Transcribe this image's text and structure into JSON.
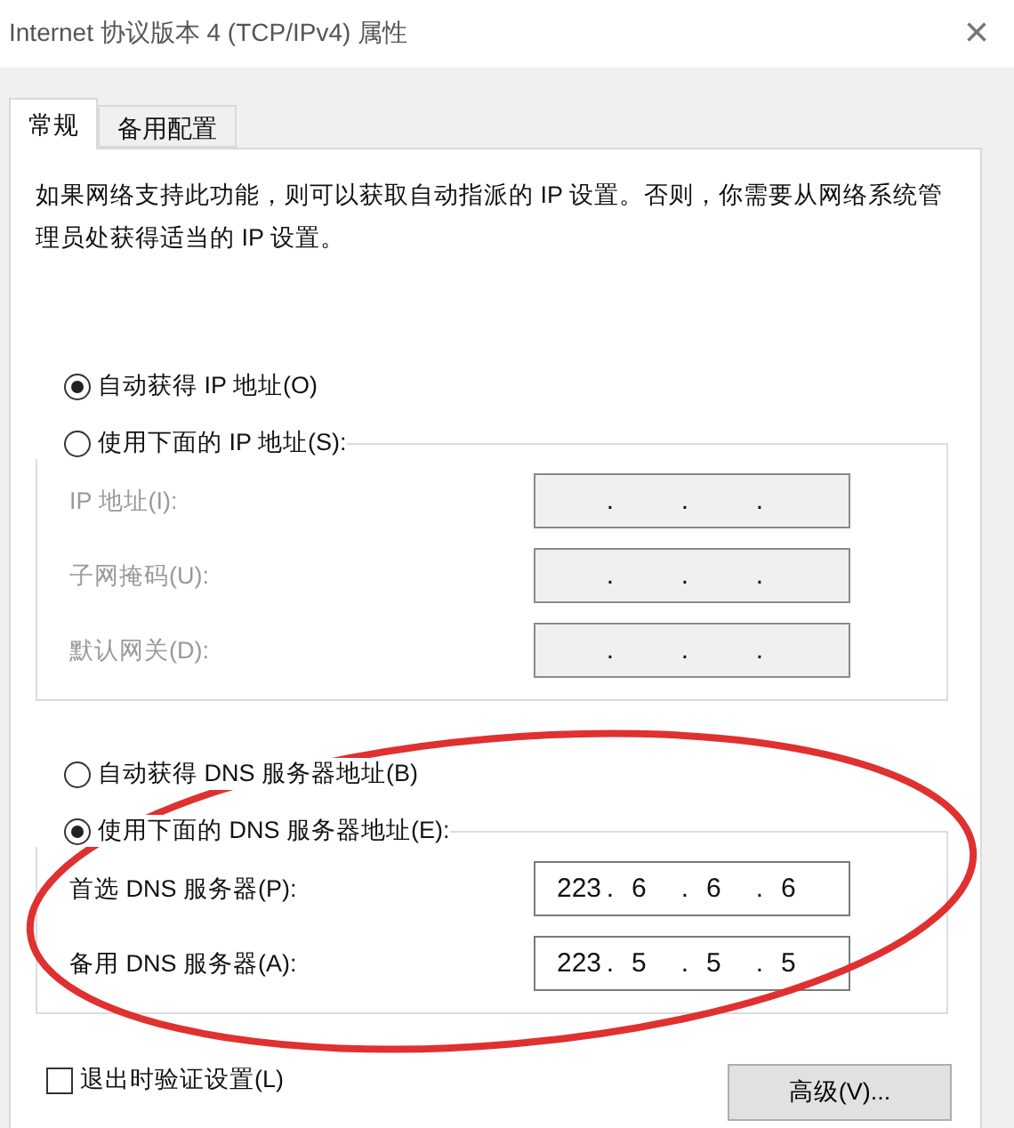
{
  "window": {
    "title": "Internet 协议版本 4 (TCP/IPv4) 属性",
    "close": "×"
  },
  "tabs": [
    {
      "label": "常规",
      "selected": true
    },
    {
      "label": "备用配置",
      "selected": false
    }
  ],
  "description": "如果网络支持此功能，则可以获取自动指派的 IP 设置。否则，你需要从网络系统管理员处获得适当的 IP 设置。",
  "ip_mode": [
    {
      "label": "自动获得 IP 地址(O)",
      "selected": true
    },
    {
      "label": "使用下面的 IP 地址(S):",
      "selected": false
    }
  ],
  "ip_fields": [
    {
      "label": "IP 地址(I):",
      "separators": [
        ".",
        ".",
        "."
      ],
      "disabled": true
    },
    {
      "label": "子网掩码(U):",
      "separators": [
        ".",
        ".",
        "."
      ],
      "disabled": true
    },
    {
      "label": "默认网关(D):",
      "separators": [
        ".",
        ".",
        "."
      ],
      "disabled": true
    }
  ],
  "dns_mode": [
    {
      "label": "自动获得 DNS 服务器地址(B)",
      "selected": false
    },
    {
      "label": "使用下面的 DNS 服务器地址(E):",
      "selected": true
    }
  ],
  "dns_fields": [
    {
      "label": "首选 DNS 服务器(P):",
      "octets": [
        "223",
        "6",
        "6",
        "6"
      ],
      "separators": [
        ".",
        ".",
        "."
      ],
      "disabled": false
    },
    {
      "label": "备用 DNS 服务器(A):",
      "octets": [
        "223",
        "5",
        "5",
        "5"
      ],
      "separators": [
        ".",
        ".",
        "."
      ],
      "disabled": false
    }
  ],
  "validate": {
    "label": "退出时验证设置(L)",
    "checked": false
  },
  "advanced_button": "高级(V)..."
}
